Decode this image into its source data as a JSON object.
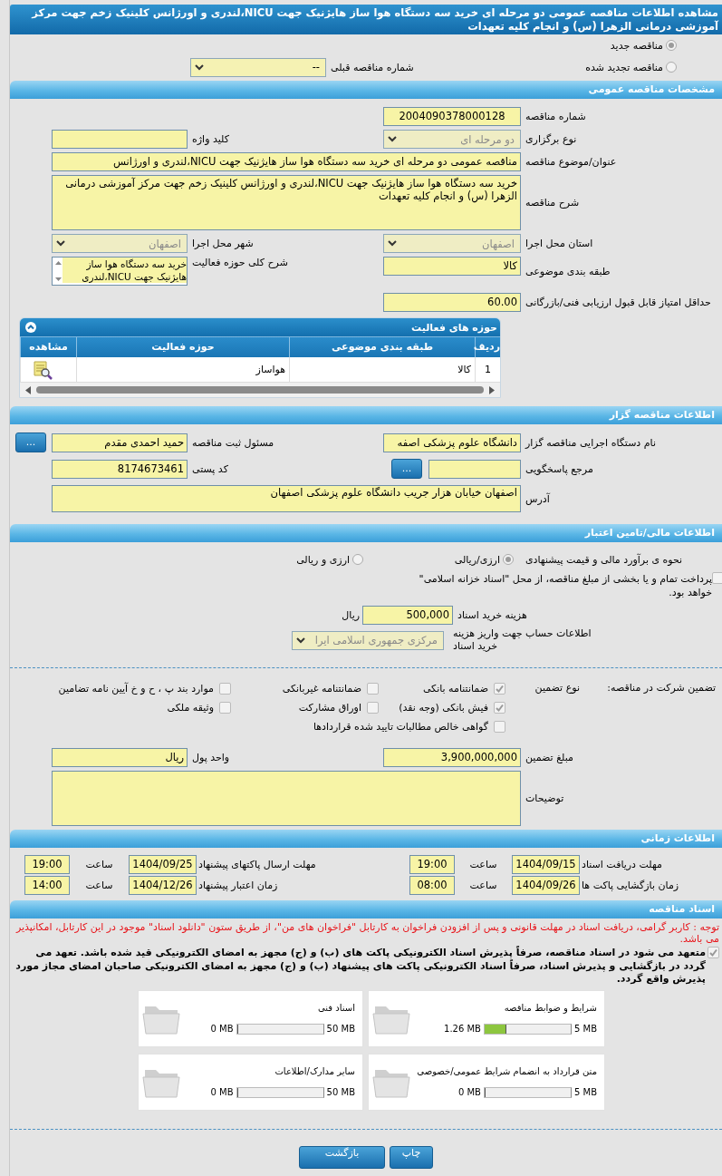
{
  "title": "مشاهده اطلاعات مناقصه عمومی دو مرحله ای خرید سه دستگاه هوا ساز هایژنیک جهت NICU،لندری و اورژانس کلینیک زخم جهت مرکز آموزشی درمانی الزهرا (س) و انجام کلیه تعهدات",
  "tender_type": {
    "options": [
      {
        "label": "مناقصه جدید",
        "selected": true
      },
      {
        "label": "مناقصه تجدید شده",
        "selected": false
      }
    ],
    "previous": {
      "label": "شماره مناقصه قبلی",
      "value": "--",
      "disabled": false
    }
  },
  "general": {
    "heading": "مشخصات مناقصه عمومی",
    "rows": [
      [
        {
          "label": "شماره مناقصه",
          "kind": "input-center",
          "value": "2004090378000128"
        }
      ],
      [
        {
          "label": "نوع برگزاری",
          "kind": "select",
          "value": "دو مرحله ای",
          "disabled": true
        },
        {
          "label": "کلید واژه",
          "kind": "input"
        }
      ],
      [
        {
          "label": "عنوان/موضوع مناقصه",
          "kind": "wide-input",
          "value": "مناقصه عمومی دو مرحله ای خرید سه دستگاه هوا ساز هایژنیک جهت NICU،لندری و اورژانس"
        }
      ],
      [
        {
          "label": "شرح مناقصه",
          "kind": "textarea",
          "value": "خرید سه دستگاه هوا ساز هایژنیک جهت NICU،لندری و اورژانس کلینیک زخم جهت مرکز آموزشی درمانی الزهرا (س) و انجام کلیه تعهدات"
        }
      ],
      [
        {
          "label": "استان محل اجرا",
          "kind": "select",
          "value": "اصفهان",
          "disabled": true
        },
        {
          "label": "شهر محل اجرا",
          "kind": "select",
          "value": "اصفهان",
          "disabled": true
        }
      ],
      [
        {
          "label": "طبقه بندی موضوعی",
          "kind": "input",
          "value": "کالا"
        },
        {
          "label": "شرح کلی حوزه فعالیت",
          "kind": "listbox",
          "value": "خرید سه دستگاه هوا ساز هایژنیک جهت NICU،لندری"
        }
      ]
    ],
    "min_score": {
      "label": "حداقل امتیاز قابل قبول ارزیابی فنی/بازرگانی",
      "value": "60.00"
    },
    "activities": {
      "title": "حوزه های فعالیت",
      "columns": [
        "ردیف",
        "طبقه بندی موضوعی",
        "حوزه فعالیت",
        "مشاهده"
      ],
      "rows": [
        {
          "cells": [
            "1",
            "کالا",
            "هواساز"
          ]
        }
      ]
    }
  },
  "organizer": {
    "heading": "اطلاعات مناقصه گزار",
    "rows": [
      [
        {
          "label": "نام دستگاه اجرایی مناقصه گزار",
          "kind": "input",
          "value": "دانشگاه علوم پزشکی اصفه"
        },
        {
          "label": "مسئول ثبت مناقصه",
          "kind": "input-button",
          "value": "حمید احمدی مقدم",
          "button": "..."
        }
      ],
      [
        {
          "label": "مرجع پاسخگویی",
          "kind": "input-button",
          "button": "..."
        },
        {
          "label": "کد پستی",
          "kind": "input",
          "value": "8174673461"
        }
      ],
      [
        {
          "label": "آدرس",
          "kind": "address",
          "value": "اصفهان خیابان هزار جریب دانشگاه علوم پزشکی اصفهان"
        }
      ]
    ]
  },
  "finance": {
    "heading": "اطلاعات مالی/تامین اعتبار",
    "estimate": {
      "label": "نحوه ی برآورد مالی و قیمت پیشنهادی",
      "options": [
        {
          "label": "ارزی/ریالی",
          "selected": true
        },
        {
          "label": "ارزی و ریالی",
          "selected": false
        }
      ]
    },
    "treasury": {
      "label": "پرداخت تمام و یا بخشی از مبلغ مناقصه، از محل \"اسناد خزانه اسلامی\" خواهد بود.",
      "checked": false
    },
    "doc_fee": {
      "label": "هزینه خرید اسناد",
      "value": "500,000",
      "unit": "ریال"
    },
    "account": {
      "label": "اطلاعات حساب جهت واریز هزینه خرید اسناد",
      "value": "مرکزی جمهوری اسلامی ایرا",
      "disabled": true
    },
    "guarantee": {
      "label": "تضمین شرکت در مناقصه:",
      "type_label": "نوع تضمین",
      "options": [
        {
          "label": "ضمانتنامه بانکی",
          "checked": true
        },
        {
          "label": "ضمانتنامه غیربانکی",
          "checked": false
        },
        {
          "label": "موارد بند پ ، ح و خ آیین نامه تضامین",
          "checked": false
        },
        {
          "label": "فیش بانکی (وجه نقد)",
          "checked": true
        },
        {
          "label": "اوراق مشارکت",
          "checked": false
        },
        {
          "label": "وثیقه ملکی",
          "checked": false
        },
        {
          "label": "گواهی خالص مطالبات تایید شده قراردادها",
          "checked": false
        }
      ]
    },
    "rows": [
      [
        {
          "label": "مبلغ تضمین",
          "kind": "input",
          "value": "3,900,000,000"
        },
        {
          "label": "واحد پول",
          "kind": "input",
          "value": "ریال"
        }
      ],
      [
        {
          "label": "توضیحات",
          "kind": "textarea"
        }
      ]
    ]
  },
  "timing": {
    "heading": "اطلاعات زمانی",
    "rows": [
      [
        {
          "label": "مهلت دریافت اسناد",
          "date": "1404/09/15",
          "time_label": "ساعت",
          "time": "19:00"
        },
        {
          "label": "مهلت ارسال پاکتهای پیشنهاد",
          "date": "1404/09/25",
          "time_label": "ساعت",
          "time": "19:00"
        }
      ],
      [
        {
          "label": "زمان بازگشایی پاکت ها",
          "date": "1404/09/26",
          "time_label": "ساعت",
          "time": "08:00"
        },
        {
          "label": "زمان اعتبار پیشنهاد",
          "date": "1404/12/26",
          "time_label": "ساعت",
          "time": "14:00"
        }
      ]
    ]
  },
  "documents": {
    "heading": "اسناد مناقصه",
    "notice": "توجه : کاربر گرامی، دریافت اسناد در مهلت قانونی و پس از افزودن فراخوان به کارتابل \"فراخوان های من\"، از طریق ستون \"دانلود اسناد\" موجود در این کارتابل، امکانپذیر می باشد.",
    "pledge": {
      "text": "متعهد می شود در اسناد مناقصه، صرفاً پذیرش اسناد الکترونیکی پاکت های (ب) و (ج) مجهز به امضای الکترونیکی قید شده باشد. تعهد می گردد در بازگشایی و پذیرش اسناد، صرفاً اسناد الکترونیکی پاکت های پیشنهاد (ب) و (ج) مجهز به امضای الکترونیکی صاحبان امضای مجاز مورد پذیرش واقع گردد.",
      "checked": true
    },
    "files": [
      {
        "title": "شرایط و ضوابط مناقصه",
        "max": "5 MB",
        "used": "1.26 MB",
        "level": 0.252
      },
      {
        "title": "اسناد فنی",
        "max": "50 MB",
        "used": "0 MB",
        "level": 0
      },
      {
        "title": "متن قرارداد به انضمام شرایط عمومی/خصوصی",
        "max": "5 MB",
        "used": "0 MB",
        "level": 0
      },
      {
        "title": "سایر مدارک/اطلاعات",
        "max": "50 MB",
        "used": "0 MB",
        "level": 0
      }
    ]
  },
  "buttons": [
    "چاپ",
    "بازگشت"
  ]
}
